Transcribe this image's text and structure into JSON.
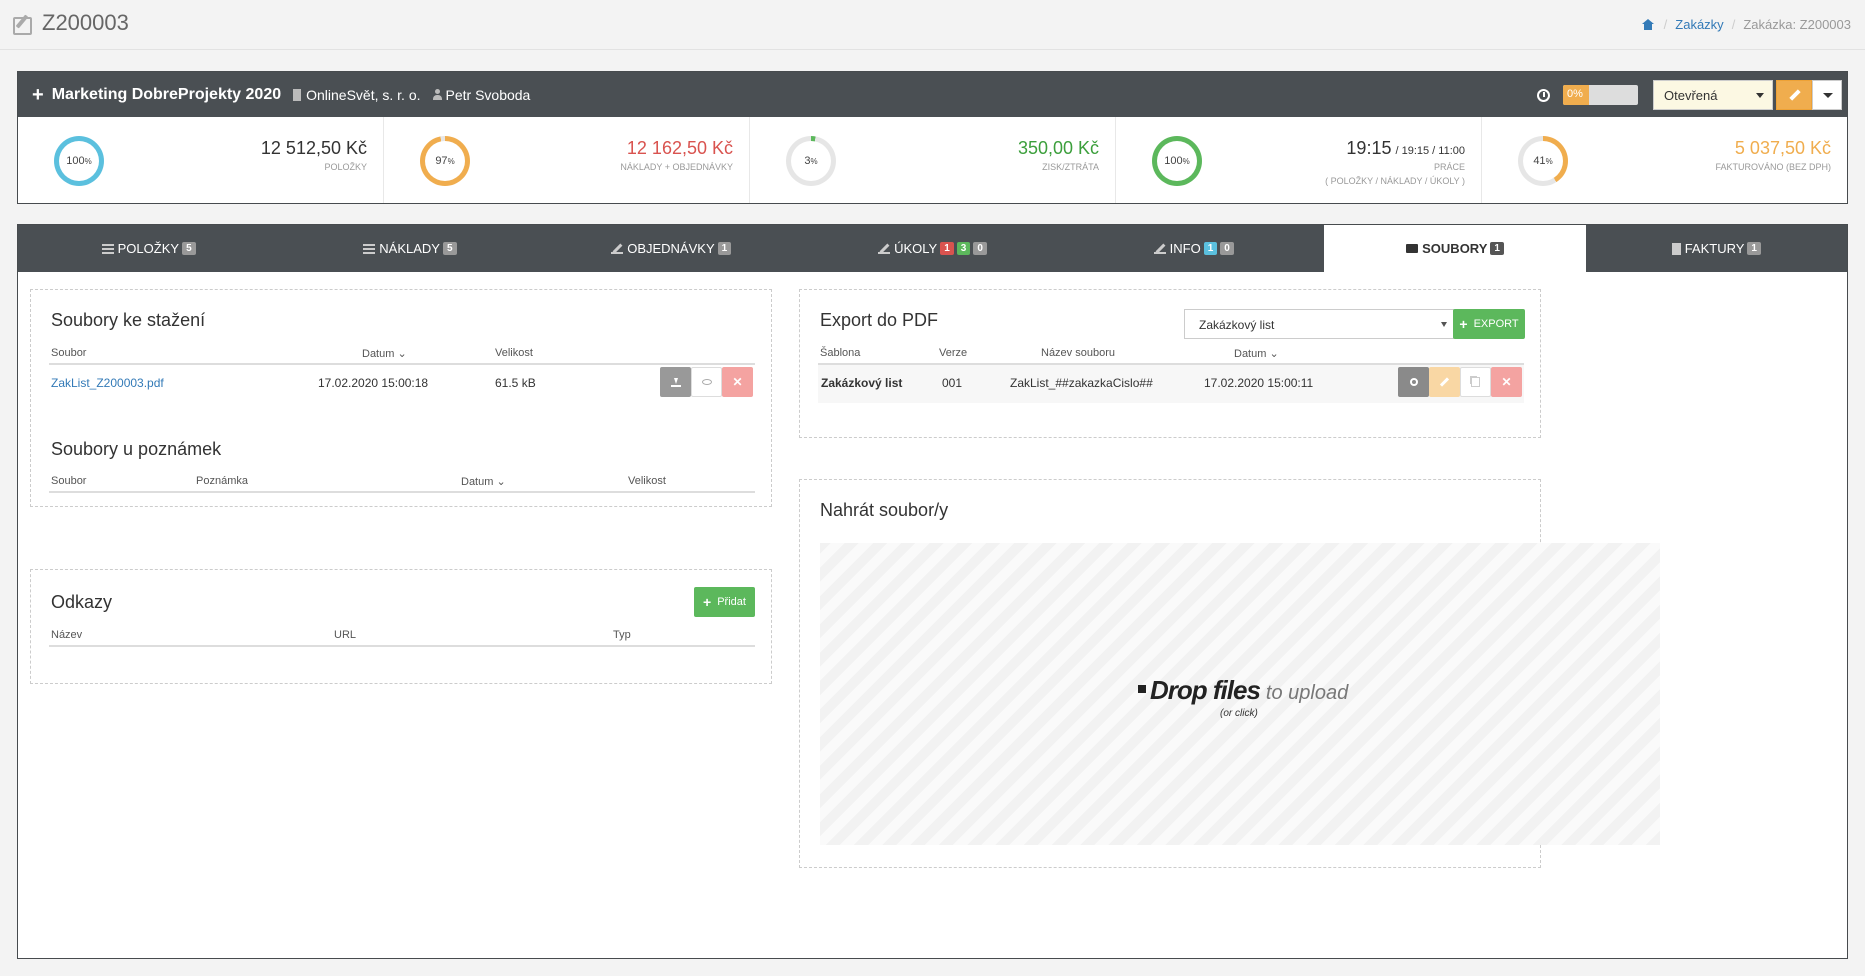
{
  "page": {
    "title": "Z200003"
  },
  "breadcrumb": {
    "item1": "Zakázky",
    "item2": "Zakázka: Z200003"
  },
  "project": {
    "name": "Marketing DobreProjekty 2020",
    "company": "OnlineSvět, s. r. o.",
    "person": "Petr Svoboda",
    "progress": "0%",
    "progress_value": 0,
    "status": "Otevřená",
    "colors": {
      "accent": "#f0ad4e",
      "header": "#4a4f53"
    }
  },
  "stats": [
    {
      "percent": "100",
      "value": "12 512,50 Kč",
      "label": "POLOŽKY",
      "color": "#5bc0de",
      "fill": 100
    },
    {
      "percent": "97",
      "value": "12 162,50 Kč",
      "label": "NÁKLADY + OBJEDNÁVKY",
      "color": "#f0ad4e",
      "fill": 97,
      "valueColor": "#d9534f"
    },
    {
      "percent": "3",
      "value": "350,00 Kč",
      "label": "ZISK/ZTRÁTA",
      "color": "#5cb85c",
      "fill": 3,
      "valueColor": "#3c9f3c"
    },
    {
      "percent": "100",
      "value": "19:15",
      "value_extra": "/ 19:15 / 11:00",
      "label": "PRÁCE",
      "label2": "( POLOŽKY / NÁKLADY / ÚKOLY )",
      "color": "#5cb85c",
      "fill": 100
    },
    {
      "percent": "41",
      "value": "5 037,50 Kč",
      "label": "FAKTUROVÁNO (BEZ DPH)",
      "color": "#f0ad4e",
      "fill": 41,
      "valueColor": "#f0ad4e"
    }
  ],
  "tabs": [
    {
      "label": "POLOŽKY",
      "badges": [
        "5"
      ]
    },
    {
      "label": "NÁKLADY",
      "badges": [
        "5"
      ]
    },
    {
      "label": "OBJEDNÁVKY",
      "badges": [
        "1"
      ]
    },
    {
      "label": "ÚKOLY",
      "badges": [
        "1",
        "3",
        "0"
      ]
    },
    {
      "label": "INFO",
      "badges": [
        "1",
        "0"
      ]
    },
    {
      "label": "SOUBORY",
      "badges": [
        "1"
      ]
    },
    {
      "label": "FAKTURY",
      "badges": [
        "1"
      ]
    }
  ],
  "downloads": {
    "title": "Soubory ke stažení",
    "columns": [
      "Soubor",
      "Datum",
      "Velikost"
    ],
    "rows": [
      {
        "file": "ZakList_Z200003.pdf",
        "date": "17.02.2020 15:00:18",
        "size": "61.5 kB"
      }
    ]
  },
  "notes_files": {
    "title": "Soubory u poznámek",
    "columns": [
      "Soubor",
      "Poznámka",
      "Datum",
      "Velikost"
    ]
  },
  "links": {
    "title": "Odkazy",
    "add_label": "Přidat",
    "columns": [
      "Název",
      "URL",
      "Typ"
    ]
  },
  "export": {
    "title": "Export do PDF",
    "template_value": "Zakázkový list",
    "button": "EXPORT",
    "columns": [
      "Šablona",
      "Verze",
      "Název souboru",
      "Datum"
    ],
    "rows": [
      {
        "template": "Zakázkový list",
        "version": "001",
        "filename": "ZakList_##zakazkaCislo##",
        "date": "17.02.2020 15:00:11"
      }
    ]
  },
  "upload": {
    "title": "Nahrát soubor/y",
    "drop_main": "Drop files",
    "drop_sub": "to upload",
    "drop_hint": "(or click)"
  }
}
